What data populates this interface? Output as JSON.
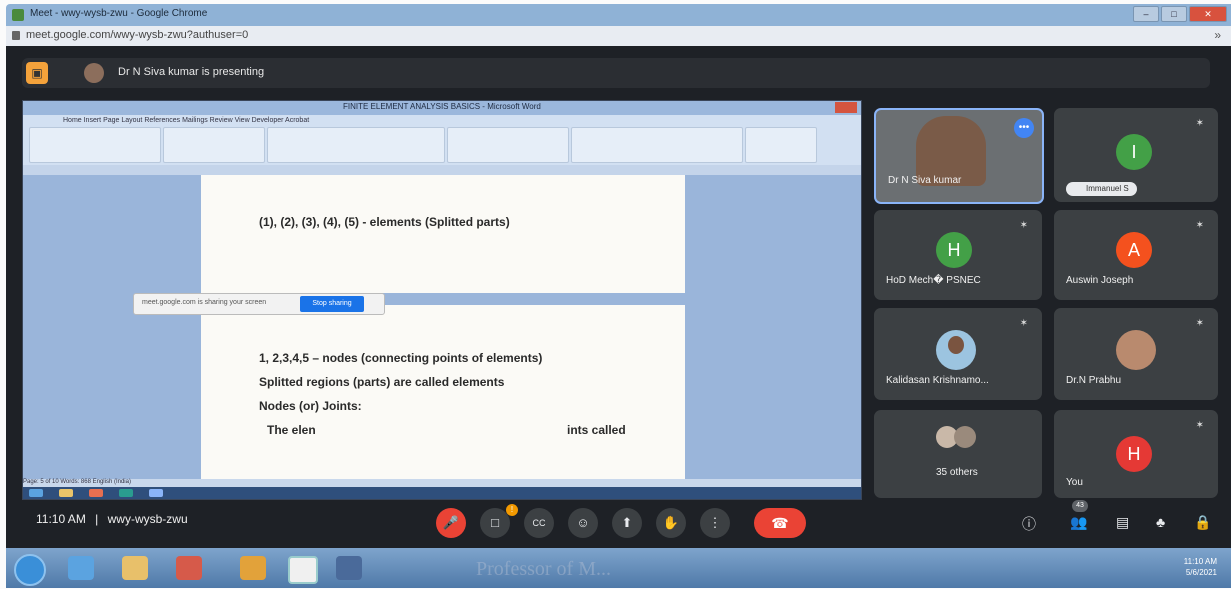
{
  "window": {
    "title": "Meet - wwy-wysb-zwu - Google Chrome",
    "minimize": "–",
    "maximize": "□",
    "close": "✕"
  },
  "url": "meet.google.com/wwy-wysb-zwu?authuser=0",
  "presenting_banner": "Dr N Siva kumar is presenting",
  "shared_screen": {
    "word_title": "FINITE ELEMENT ANALYSIS BASICS - Microsoft Word",
    "ribbon_tabs": "Home   Insert   Page Layout   References   Mailings   Review   View   Developer   Acrobat",
    "page1_line": "(1), (2), (3), (4), (5) - elements (Splitted parts)",
    "page2_lines": [
      "1, 2,3,4,5 – nodes (connecting points of elements)",
      "Splitted regions (parts) are called elements",
      "Nodes (or) Joints:",
      "The elen",
      "ints called"
    ],
    "share_msg": "meet.google.com is sharing your screen",
    "stop_sharing": "Stop sharing",
    "status": "Page: 5 of 10   Words: 868   English (India)"
  },
  "participants": [
    {
      "name": "Dr N Siva kumar",
      "type": "video"
    },
    {
      "name": "Immanuel S",
      "initial": "I",
      "color": "#43a047"
    },
    {
      "name": "HoD Mech� PSNEC",
      "initial": "H",
      "color": "#43a047"
    },
    {
      "name": "Auswin Joseph",
      "initial": "A",
      "color": "#f4511e"
    },
    {
      "name": "Kalidasan Krishnamo...",
      "type": "photo"
    },
    {
      "name": "Dr.N Prabhu",
      "type": "photo"
    },
    {
      "name": "35 others",
      "type": "group"
    },
    {
      "name": "You",
      "initial": "H",
      "color": "#e53935"
    }
  ],
  "controls": {
    "time": "11:10 AM",
    "separator": "|",
    "meeting_code": "wwy-wysb-zwu",
    "people_count": "43"
  },
  "icons": {
    "mic_off": "🎤",
    "cam": "□",
    "cc": "CC",
    "emoji": "☺",
    "present": "⬆",
    "hand": "✋",
    "more": "⋮",
    "end": "☎",
    "info": "ⓘ",
    "people": "👥",
    "chat": "▤",
    "activities": "♣",
    "lock": "🔒"
  },
  "taskbar": {
    "clock": "11:10 AM",
    "date": "5/6/2021"
  },
  "watermark": "Professor of M..."
}
